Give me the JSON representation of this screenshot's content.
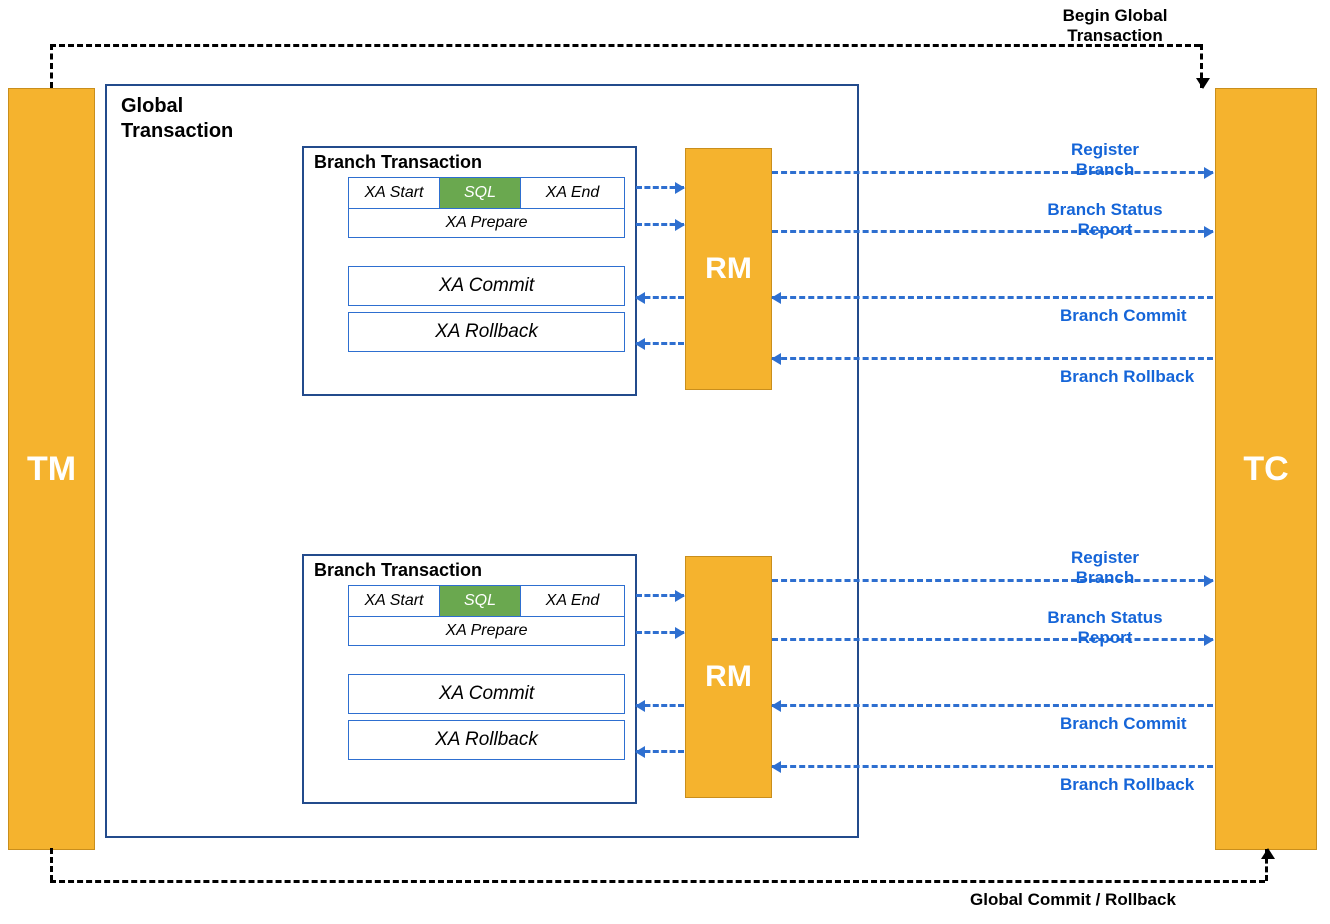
{
  "tm": {
    "label": "TM"
  },
  "tc": {
    "label": "TC"
  },
  "global_transaction": {
    "title": "Global\nTransaction",
    "branches": [
      {
        "title": "Branch Transaction",
        "xa_start": "XA Start",
        "sql": "SQL",
        "xa_end": "XA End",
        "xa_prepare": "XA Prepare",
        "xa_commit": "XA Commit",
        "xa_rollback": "XA Rollback"
      },
      {
        "title": "Branch Transaction",
        "xa_start": "XA Start",
        "sql": "SQL",
        "xa_end": "XA End",
        "xa_prepare": "XA Prepare",
        "xa_commit": "XA Commit",
        "xa_rollback": "XA Rollback"
      }
    ]
  },
  "rm": {
    "label": "RM"
  },
  "connectors": {
    "begin_global": "Begin Global\nTransaction",
    "global_commit_rollback": "Global Commit / Rollback",
    "register_branch": "Register\nBranch",
    "branch_status_report": "Branch Status\nReport",
    "branch_commit": "Branch Commit",
    "branch_rollback": "Branch Rollback"
  }
}
